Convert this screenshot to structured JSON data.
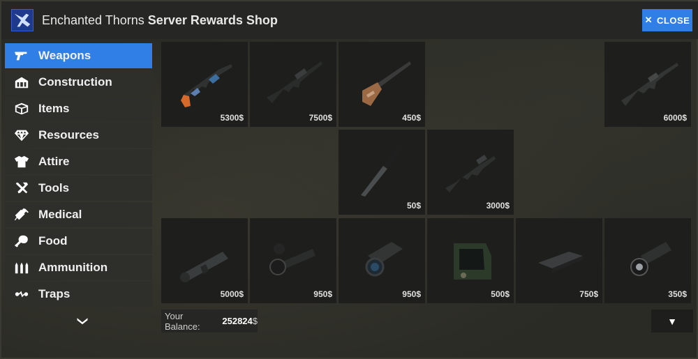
{
  "header": {
    "title_server": "Enchanted Thorns",
    "title_shop": "Server Rewards Shop",
    "close_label": "CLOSE",
    "accent_color": "#2f7fe6"
  },
  "sidebar": {
    "items": [
      {
        "label": "Weapons",
        "icon": "pistol-icon",
        "active": true
      },
      {
        "label": "Construction",
        "icon": "building-icon",
        "active": false
      },
      {
        "label": "Items",
        "icon": "box-icon",
        "active": false
      },
      {
        "label": "Resources",
        "icon": "diamond-icon",
        "active": false
      },
      {
        "label": "Attire",
        "icon": "tshirt-icon",
        "active": false
      },
      {
        "label": "Tools",
        "icon": "hammer-wrench-icon",
        "active": false
      },
      {
        "label": "Medical",
        "icon": "syringe-icon",
        "active": false
      },
      {
        "label": "Food",
        "icon": "drumstick-icon",
        "active": false
      },
      {
        "label": "Ammunition",
        "icon": "bullets-icon",
        "active": false
      },
      {
        "label": "Traps",
        "icon": "tripwire-icon",
        "active": false
      }
    ],
    "scroll_icon": "chevron-down-icon"
  },
  "shop": {
    "rows": [
      [
        {
          "price": "5300$",
          "icon": "assault-rifle-icon"
        },
        {
          "price": "7500$",
          "icon": "lr300-rifle-icon"
        },
        {
          "price": "450$",
          "icon": "double-barrel-shotgun-icon"
        },
        null,
        null,
        {
          "price": "6000$",
          "icon": "m249-rifle-icon"
        }
      ],
      [
        null,
        null,
        {
          "price": "50$",
          "icon": "combat-knife-icon"
        },
        {
          "price": "3000$",
          "icon": "mp5-smg-icon"
        },
        null,
        null
      ],
      [
        {
          "price": "5000$",
          "icon": "rocket-launcher-icon"
        },
        {
          "price": "950$",
          "icon": "scope-8x-icon"
        },
        {
          "price": "950$",
          "icon": "scope-16x-icon"
        },
        {
          "price": "500$",
          "icon": "holosight-icon"
        },
        {
          "price": "750$",
          "icon": "weapon-lasersight-icon"
        },
        {
          "price": "350$",
          "icon": "flashlight-attachment-icon"
        }
      ]
    ]
  },
  "footer": {
    "balance_label": "Your Balance:",
    "balance_value": "252824",
    "balance_currency": "$",
    "page_button_glyph": "▼"
  }
}
